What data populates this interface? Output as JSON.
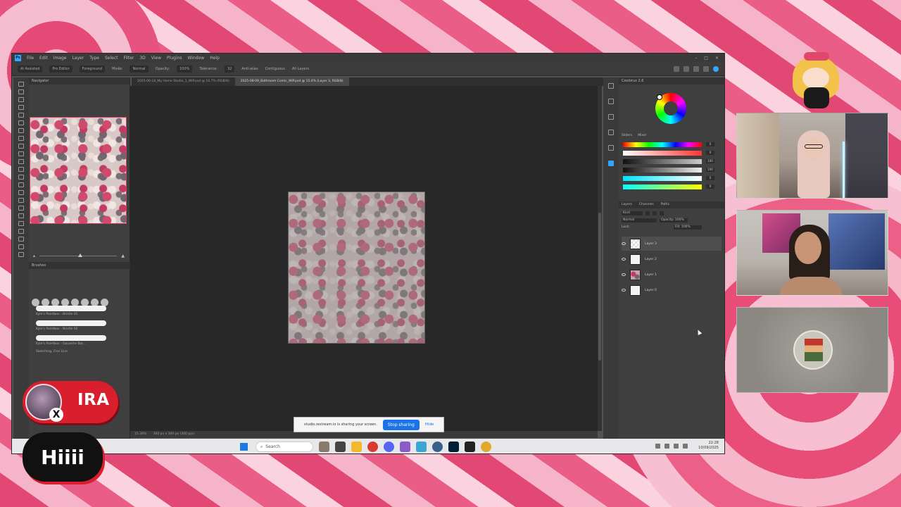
{
  "app": {
    "title_menus": [
      "File",
      "Edit",
      "Image",
      "Layer",
      "Type",
      "Select",
      "Filter",
      "3D",
      "View",
      "Plugins",
      "Window",
      "Help"
    ],
    "options": [
      "AI Assisted",
      "Pro Editor",
      "Foreground",
      "Mode:",
      "Normal",
      "Opacity:",
      "100%",
      "Tolerance:",
      "32",
      "Anti-alias",
      "Contiguous",
      "All Layers"
    ]
  },
  "tabs": [
    "2025-06-18_My Home Studio_1_WIP.psd @ 16.7% (RGB/8)",
    "2025-08-09_Bathroom Comic_WIP.psd @ 15.4% (Layer 3, RGB/8)"
  ],
  "left_panel": {
    "navigator_label": "Navigator",
    "brushes_label": "Brushes",
    "brush_names": [
      "Kyle's Paintbox - Bristle 01",
      "Kyle's Paintbox - Bristle 02",
      "Kyle's Paintbox - Gouache Bar...",
      "Sketching, Fine Line"
    ]
  },
  "status": {
    "zoom": "15.38%",
    "doc": "360 px x 360 px (300 ppi)"
  },
  "right_panel": {
    "color_label": "Coolorus 2.6",
    "slider_tabs": [
      "Sliders",
      "Mixer"
    ],
    "slider_values": [
      "0",
      "0",
      "100",
      "100",
      "0",
      "0"
    ],
    "layers_tabs": [
      "Layers",
      "Channels",
      "Paths"
    ],
    "kind_label": "Kind",
    "blend": "Normal",
    "opacity": "Opacity: 100%",
    "lock": "Lock:",
    "fill": "Fill: 100%",
    "layers": [
      "Layer 3",
      "Layer 2",
      "Layer 1",
      "Layer 0"
    ]
  },
  "sharing": {
    "message": "studio.restream.io is sharing your screen.",
    "stop": "Stop sharing",
    "hide": "Hide"
  },
  "taskbar": {
    "search": "Search",
    "time": "22:28",
    "date": "10/09/2025"
  },
  "overlays": {
    "guest_name": "IRA",
    "chat_message": "Hiiii",
    "guest_x": "X"
  },
  "colors": {
    "ps_blue": "#31a8ff",
    "badge_red": "#d91f2e",
    "stop_blue": "#1a73e8"
  }
}
